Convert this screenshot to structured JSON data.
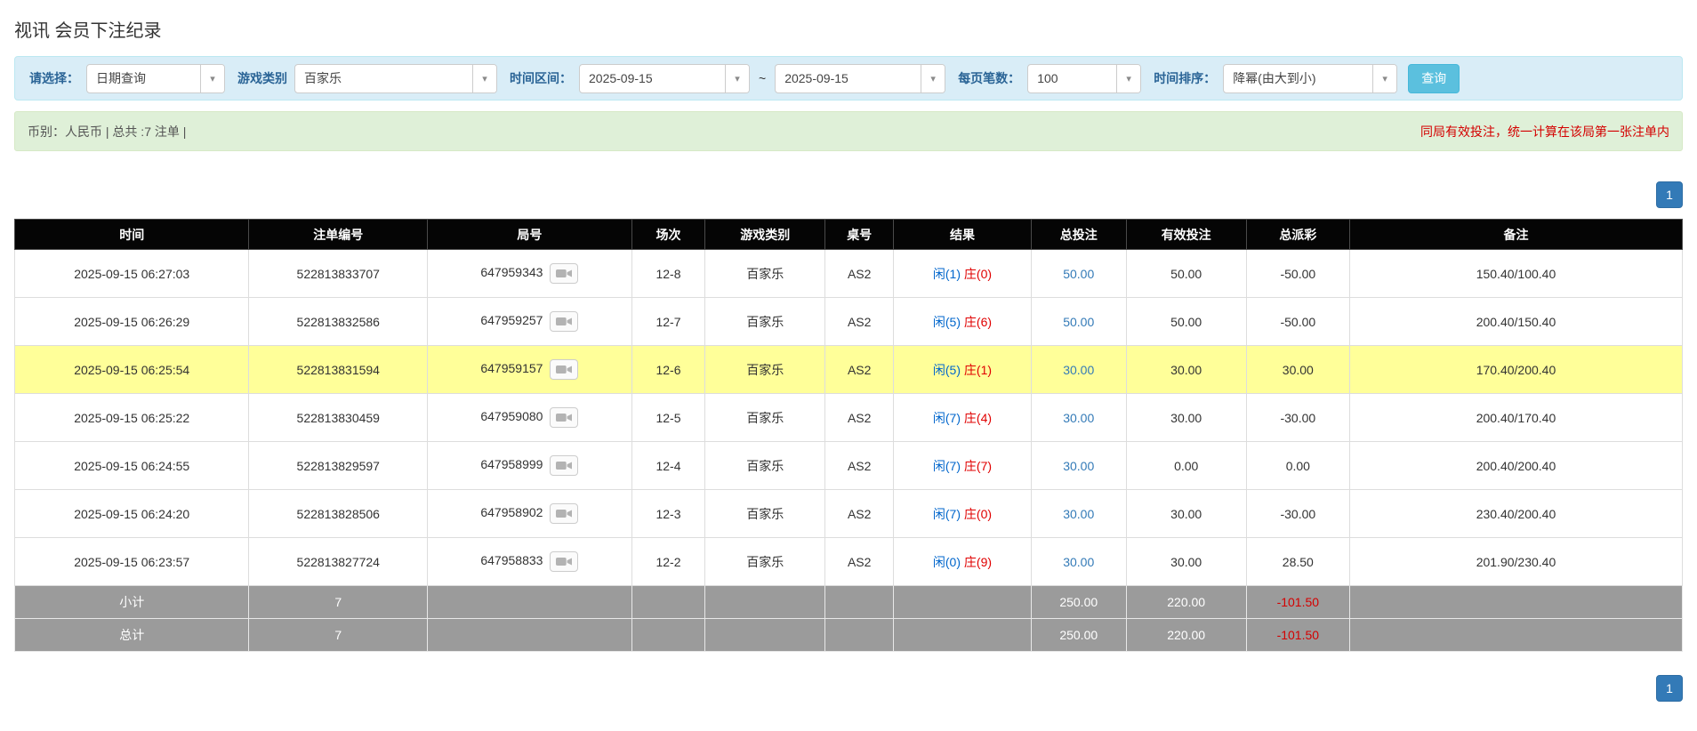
{
  "page": {
    "title": "视讯 会员下注纪录"
  },
  "icons": {
    "caret_down": "▾"
  },
  "colors": {
    "filter_bar_bg": "#d9edf7",
    "summary_bar_bg": "#dff0d8",
    "header_bg": "#050505",
    "highlight_row": "#ffff99",
    "player_blue": "#0066cc",
    "banker_red": "#e00000",
    "negative_red": "#e60000",
    "link_blue": "#337ab7",
    "search_button_blue": "#5bc0de",
    "pagination_blue": "#337ab7",
    "note_red": "#d40000"
  },
  "filters": {
    "query_type": {
      "label": "请选择：",
      "value": "日期查询"
    },
    "game_type": {
      "label": "游戏类别",
      "value": "百家乐"
    },
    "date_range": {
      "label": "时间区间：",
      "from": "2025-09-15",
      "separator": "~",
      "to": "2025-09-15"
    },
    "page_size": {
      "label": "每页笔数：",
      "value": "100"
    },
    "sort_order": {
      "label": "时间排序：",
      "value": "降幂(由大到小)"
    },
    "search_button_label": "查询"
  },
  "summary": {
    "left": "币别：人民币 | 总共 :7 注单 |",
    "right_note": "同局有效投注，统一计算在该局第一张注单内"
  },
  "pagination": {
    "page": "1"
  },
  "table": {
    "headers": [
      "时间",
      "注单编号",
      "局号",
      "场次",
      "游戏类别",
      "桌号",
      "结果",
      "总投注",
      "有效投注",
      "总派彩",
      "备注"
    ],
    "rows": [
      {
        "time": "2025-09-15 06:27:03",
        "bet_id": "522813833707",
        "round_id": "647959343",
        "session": "12-8",
        "game": "百家乐",
        "table_no": "AS2",
        "result_player": "闲(1)",
        "result_banker": "庄(0)",
        "total_bet": "50.00",
        "valid_bet": "50.00",
        "payout": "-50.00",
        "note": "150.40/100.40",
        "highlight": false
      },
      {
        "time": "2025-09-15 06:26:29",
        "bet_id": "522813832586",
        "round_id": "647959257",
        "session": "12-7",
        "game": "百家乐",
        "table_no": "AS2",
        "result_player": "闲(5)",
        "result_banker": "庄(6)",
        "total_bet": "50.00",
        "valid_bet": "50.00",
        "payout": "-50.00",
        "note": "200.40/150.40",
        "highlight": false
      },
      {
        "time": "2025-09-15 06:25:54",
        "bet_id": "522813831594",
        "round_id": "647959157",
        "session": "12-6",
        "game": "百家乐",
        "table_no": "AS2",
        "result_player": "闲(5)",
        "result_banker": "庄(1)",
        "total_bet": "30.00",
        "valid_bet": "30.00",
        "payout": "30.00",
        "note": "170.40/200.40",
        "highlight": true
      },
      {
        "time": "2025-09-15 06:25:22",
        "bet_id": "522813830459",
        "round_id": "647959080",
        "session": "12-5",
        "game": "百家乐",
        "table_no": "AS2",
        "result_player": "闲(7)",
        "result_banker": "庄(4)",
        "total_bet": "30.00",
        "valid_bet": "30.00",
        "payout": "-30.00",
        "note": "200.40/170.40",
        "highlight": false
      },
      {
        "time": "2025-09-15 06:24:55",
        "bet_id": "522813829597",
        "round_id": "647958999",
        "session": "12-4",
        "game": "百家乐",
        "table_no": "AS2",
        "result_player": "闲(7)",
        "result_banker": "庄(7)",
        "total_bet": "30.00",
        "valid_bet": "0.00",
        "payout": "0.00",
        "note": "200.40/200.40",
        "highlight": false
      },
      {
        "time": "2025-09-15 06:24:20",
        "bet_id": "522813828506",
        "round_id": "647958902",
        "session": "12-3",
        "game": "百家乐",
        "table_no": "AS2",
        "result_player": "闲(7)",
        "result_banker": "庄(0)",
        "total_bet": "30.00",
        "valid_bet": "30.00",
        "payout": "-30.00",
        "note": "230.40/200.40",
        "highlight": false
      },
      {
        "time": "2025-09-15 06:23:57",
        "bet_id": "522813827724",
        "round_id": "647958833",
        "session": "12-2",
        "game": "百家乐",
        "table_no": "AS2",
        "result_player": "闲(0)",
        "result_banker": "庄(9)",
        "total_bet": "30.00",
        "valid_bet": "30.00",
        "payout": "28.50",
        "note": "201.90/230.40",
        "highlight": false
      }
    ],
    "footer": [
      {
        "label": "小计",
        "count": "7",
        "total_bet": "250.00",
        "valid_bet": "220.00",
        "payout": "-101.50"
      },
      {
        "label": "总计",
        "count": "7",
        "total_bet": "250.00",
        "valid_bet": "220.00",
        "payout": "-101.50"
      }
    ]
  }
}
